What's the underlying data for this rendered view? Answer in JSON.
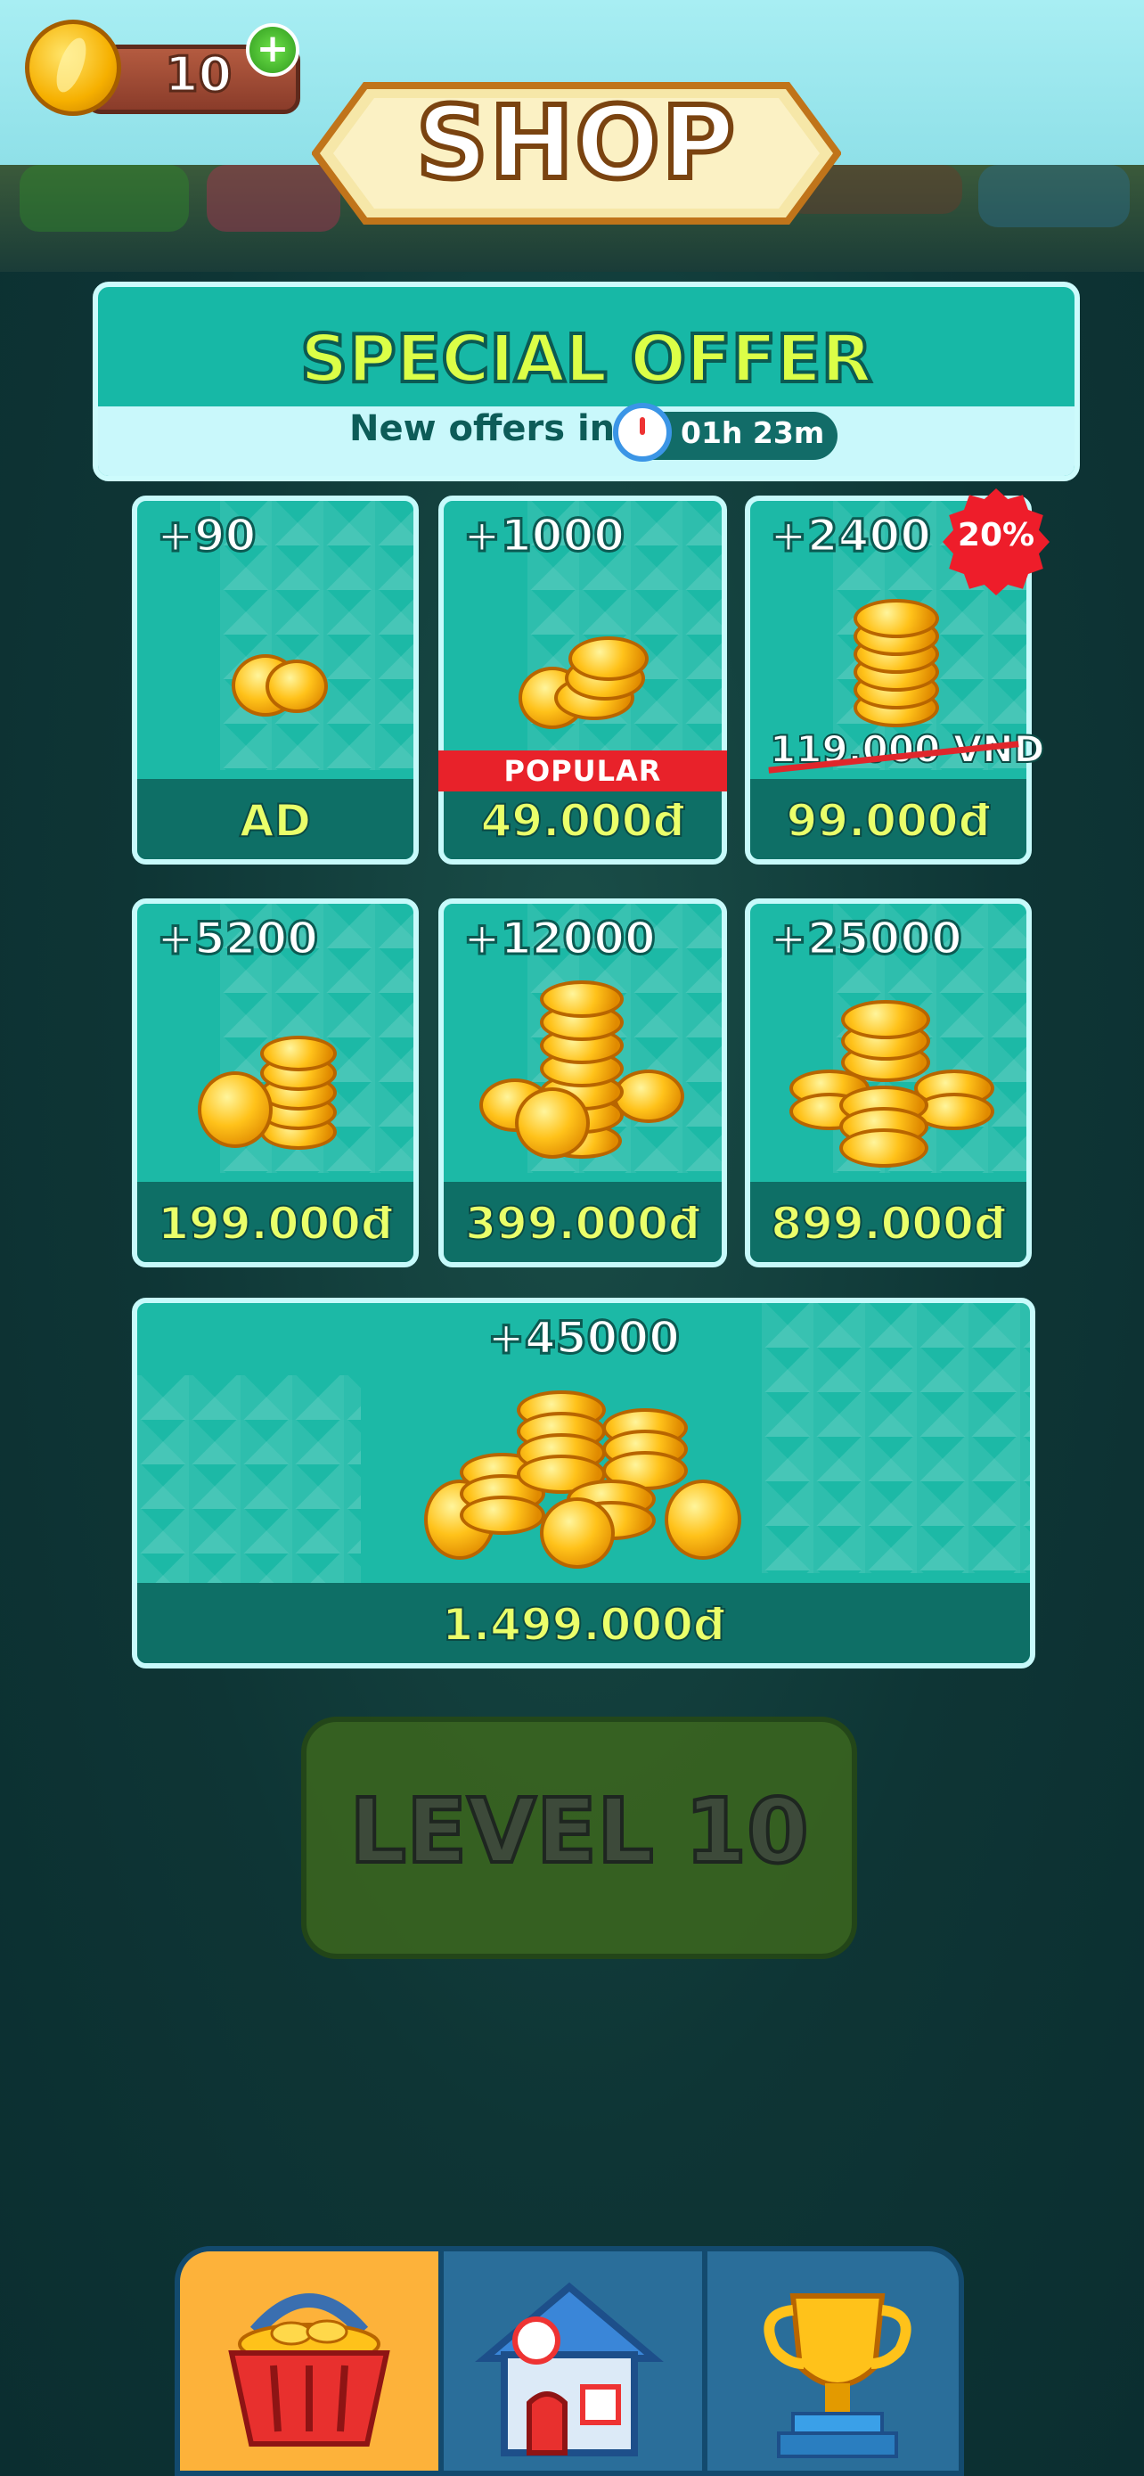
{
  "header": {
    "coins": "10",
    "add_coins_label": "+",
    "title": "SHOP"
  },
  "special_offer": {
    "title": "SPECIAL OFFER",
    "subtitle": "New offers in:",
    "timer": "01h 23m"
  },
  "packs": [
    {
      "amount": "+90",
      "price": "AD",
      "icon": "coin-small"
    },
    {
      "amount": "+1000",
      "price": "49.000đ",
      "badge": "POPULAR",
      "icon": "coin-pile"
    },
    {
      "amount": "+2400",
      "price": "99.000đ",
      "old_price": "119.000 VND",
      "discount": "20%",
      "icon": "coin-stack"
    },
    {
      "amount": "+5200",
      "price": "199.000đ",
      "icon": "coin-stack"
    },
    {
      "amount": "+12000",
      "price": "399.000đ",
      "icon": "coin-tower"
    },
    {
      "amount": "+25000",
      "price": "899.000đ",
      "icon": "coin-heap"
    },
    {
      "amount": "+45000",
      "price": "1.499.000đ",
      "icon": "coin-treasure"
    }
  ],
  "level_button": {
    "label": "LEVEL 10"
  },
  "bottom_nav": [
    {
      "name": "shop",
      "icon": "basket-icon",
      "active": true
    },
    {
      "name": "home",
      "icon": "house-icon",
      "active": false
    },
    {
      "name": "leaderboard",
      "icon": "trophy-icon",
      "active": false
    }
  ],
  "colors": {
    "card": "#1cb9a6",
    "price_text": "#eaff6a",
    "popular_badge": "#e8222a",
    "nav_active": "#fdb23a"
  }
}
